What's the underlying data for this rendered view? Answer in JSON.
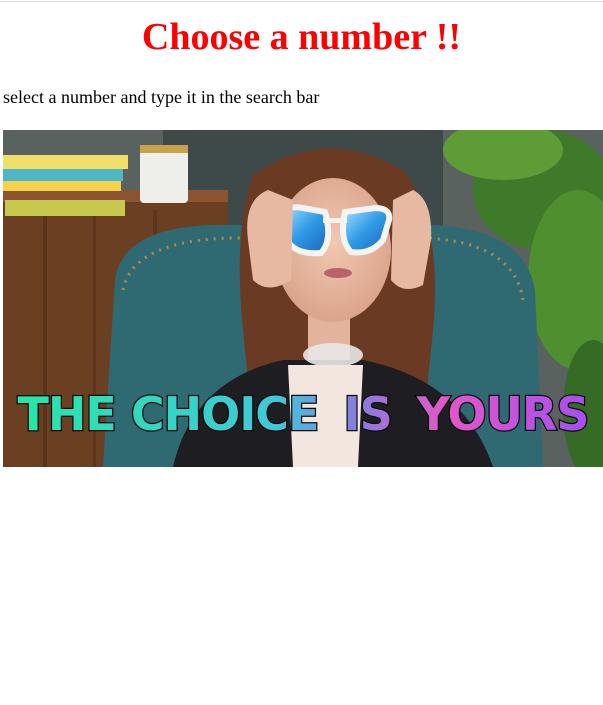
{
  "page": {
    "title": "Choose a number !!",
    "title_color": "#ff0000",
    "instruction": "select a number and type it in the search bar"
  },
  "gif": {
    "caption_part1": "THE CHOICE",
    "caption_part2": "IS",
    "caption_part3": "YOURS",
    "caption_colors": [
      "#2fe8b8",
      "#5aa0e8",
      "#e85ad0",
      "#b05af0"
    ]
  }
}
